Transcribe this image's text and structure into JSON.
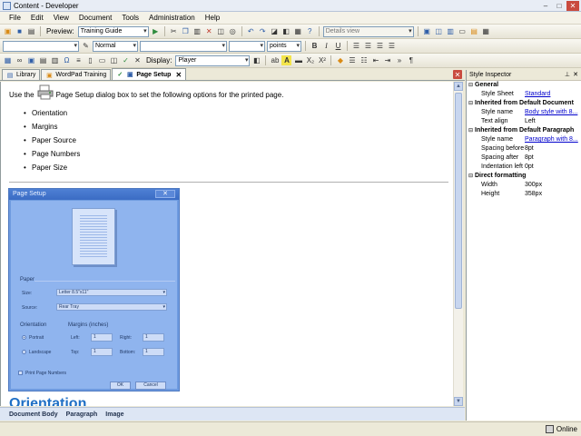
{
  "window": {
    "title": "Content - Developer"
  },
  "menu": [
    "File",
    "Edit",
    "View",
    "Document",
    "Tools",
    "Administration",
    "Help"
  ],
  "toolbar1": {
    "preview_label": "Preview:",
    "preview_value": "Training Guide",
    "view_value": "Details view"
  },
  "toolbar2": {
    "style_value": "Normal",
    "size_unit": "points"
  },
  "toolbar3": {
    "display_label": "Display:",
    "display_value": "Player"
  },
  "tabs": [
    {
      "label": "Library"
    },
    {
      "label": "WordPad Training"
    },
    {
      "label": "Page Setup"
    }
  ],
  "document": {
    "intro_before": "Use the",
    "intro_after": "Page Setup dialog box to set the following options for the printed page.",
    "bullets": [
      "Orientation",
      "Margins",
      "Paper Source",
      "Page Numbers",
      "Paper Size"
    ],
    "next_heading": "Orientation"
  },
  "dialog": {
    "title": "Page Setup",
    "close": "✕",
    "paper_group": "Paper",
    "size_label": "Size:",
    "size_value": "Letter 8.5\"x11\"",
    "source_label": "Source:",
    "source_value": "Rear Tray",
    "orientation_group": "Orientation",
    "portrait": "Portrait",
    "landscape": "Landscape",
    "margins_group": "Margins (inches)",
    "left_label": "Left:",
    "left_value": "1",
    "right_label": "Right:",
    "right_value": "1",
    "top_label": "Top:",
    "top_value": "1",
    "bottom_label": "Bottom:",
    "bottom_value": "1",
    "print_numbers": "Print Page Numbers",
    "ok": "OK",
    "cancel": "Cancel"
  },
  "breadcrumb": [
    "Document Body",
    "Paragraph",
    "Image"
  ],
  "inspector": {
    "title": "Style Inspector",
    "groups": [
      {
        "name": "General",
        "rows": [
          {
            "key": "Style Sheet",
            "value": "Standard",
            "link": true
          },
          {
            "key": "",
            "value": ""
          }
        ]
      },
      {
        "name": "Inherited from Default Document",
        "rows": [
          {
            "key": "Style name",
            "value": "Body style with 8...",
            "link": true
          },
          {
            "key": "Text align",
            "value": "Left",
            "link": false
          }
        ]
      },
      {
        "name": "Inherited from Default Paragraph",
        "rows": [
          {
            "key": "Style name",
            "value": "Paragraph with 8...",
            "link": true
          },
          {
            "key": "Spacing before",
            "value": "8pt",
            "link": false
          },
          {
            "key": "Spacing after",
            "value": "8pt",
            "link": false
          },
          {
            "key": "Indentation left",
            "value": "0pt",
            "link": false
          }
        ]
      },
      {
        "name": "Direct formatting",
        "rows": [
          {
            "key": "Width",
            "value": "300px",
            "link": false
          },
          {
            "key": "Height",
            "value": "358px",
            "link": false
          }
        ]
      }
    ]
  },
  "status": {
    "online": "Online"
  }
}
